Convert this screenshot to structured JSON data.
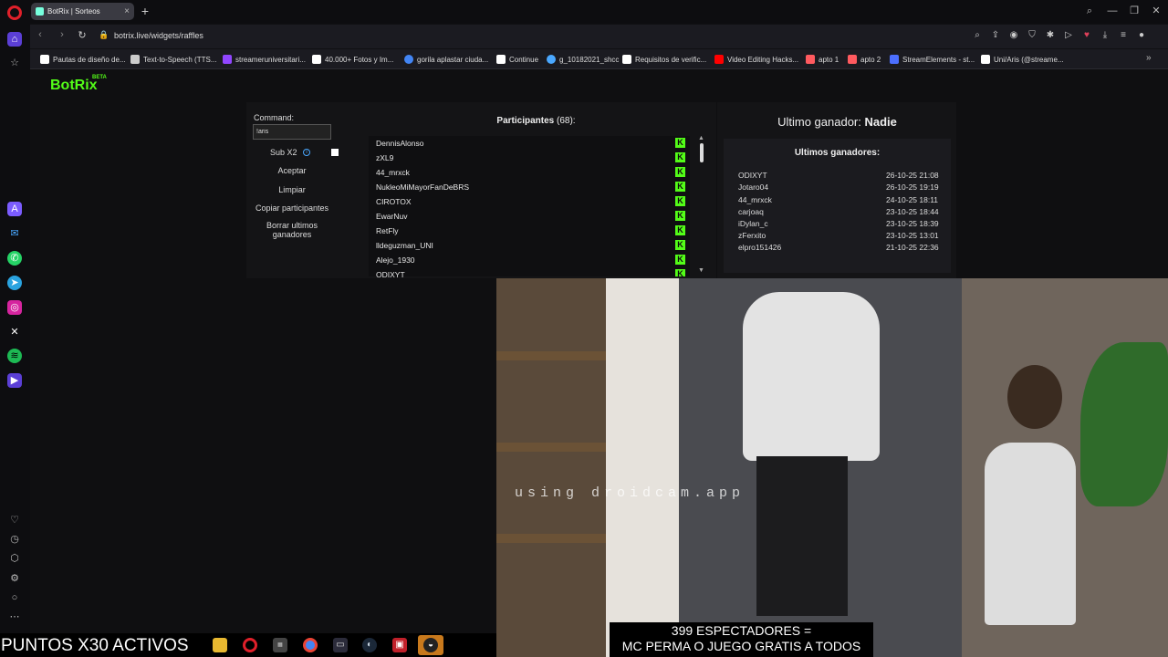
{
  "browser": {
    "tab_title": "BotRix | Sorteos",
    "new_tab": "+",
    "tab_close": "×",
    "url": "botrix.live/widgets/raffles",
    "window_controls": {
      "search": "⌕",
      "minimize": "—",
      "restore": "❐",
      "close": "✕"
    }
  },
  "bookmarks": [
    {
      "label": "Pautas de diseño de...",
      "color": "#ffffff"
    },
    {
      "label": "Text-to-Speech (TTS...",
      "color": "#cccccc"
    },
    {
      "label": "streameruniversitari...",
      "color": "#9146ff"
    },
    {
      "label": "40.000+ Fotos y Im...",
      "color": "#ffffff"
    },
    {
      "label": "gorila aplastar ciuda...",
      "color": "#4285f4"
    },
    {
      "label": "Continue",
      "color": "#ffffff"
    },
    {
      "label": "g_10182021_shcc",
      "color": "#4aa8ff"
    },
    {
      "label": "Requisitos de verific...",
      "color": "#ffffff"
    },
    {
      "label": "Video Editing Hacks...",
      "color": "#ff0000"
    },
    {
      "label": "apto 1",
      "color": "#ff5a5f"
    },
    {
      "label": "apto 2",
      "color": "#ff5a5f"
    },
    {
      "label": "StreamElements - st...",
      "color": "#4c6fff"
    },
    {
      "label": "Uni/Aris (@streame...",
      "color": "#ffffff"
    }
  ],
  "botrix": {
    "logo": "BotRix",
    "beta": "BETA"
  },
  "raffle": {
    "command_label": "Command:",
    "command_value": "!aris",
    "sub_label": "Sub X2",
    "info": "i",
    "buttons": {
      "accept": "Aceptar",
      "clear": "Limpiar",
      "copy": "Copiar participantes",
      "delete_line1": "Borrar ultimos",
      "delete_line2": "ganadores"
    },
    "participants_label": "Participantes",
    "participants_count": "(68):",
    "participants": [
      "DennisAlonso",
      "zXL9",
      "44_mrxck",
      "NukleoMiMayorFanDeBRS",
      "CIROTOX",
      "EwarNuv",
      "RetFly",
      "lldeguzman_UNI",
      "Alejo_1930",
      "ODIXYT"
    ],
    "badge": "K",
    "last_winner_label": "Ultimo ganador:",
    "last_winner_name": "Nadie",
    "winners_title": "Ultimos ganadores:",
    "winners": [
      {
        "name": "ODIXYT",
        "date": "26-10-25 21:08"
      },
      {
        "name": "Jotaro04",
        "date": "26-10-25 19:19"
      },
      {
        "name": "44_mrxck",
        "date": "24-10-25 18:11"
      },
      {
        "name": "carjoaq",
        "date": "23-10-25 18:44"
      },
      {
        "name": "iDylan_c",
        "date": "23-10-25 18:39"
      },
      {
        "name": "zFerxito",
        "date": "23-10-25 13:01"
      },
      {
        "name": "elpro151426",
        "date": "21-10-25 22:36"
      }
    ]
  },
  "overlay": {
    "watermark": "using droidcam.app",
    "spectators_line1": "399 ESPECTADORES =",
    "spectators_line2": "MC PERMA O JUEGO GRATIS A TODOS",
    "points_ticker": "PUNTOS X30 ACTIVOS"
  },
  "colors": {
    "kick_green": "#53fc18",
    "opera_red": "#e0202a"
  }
}
